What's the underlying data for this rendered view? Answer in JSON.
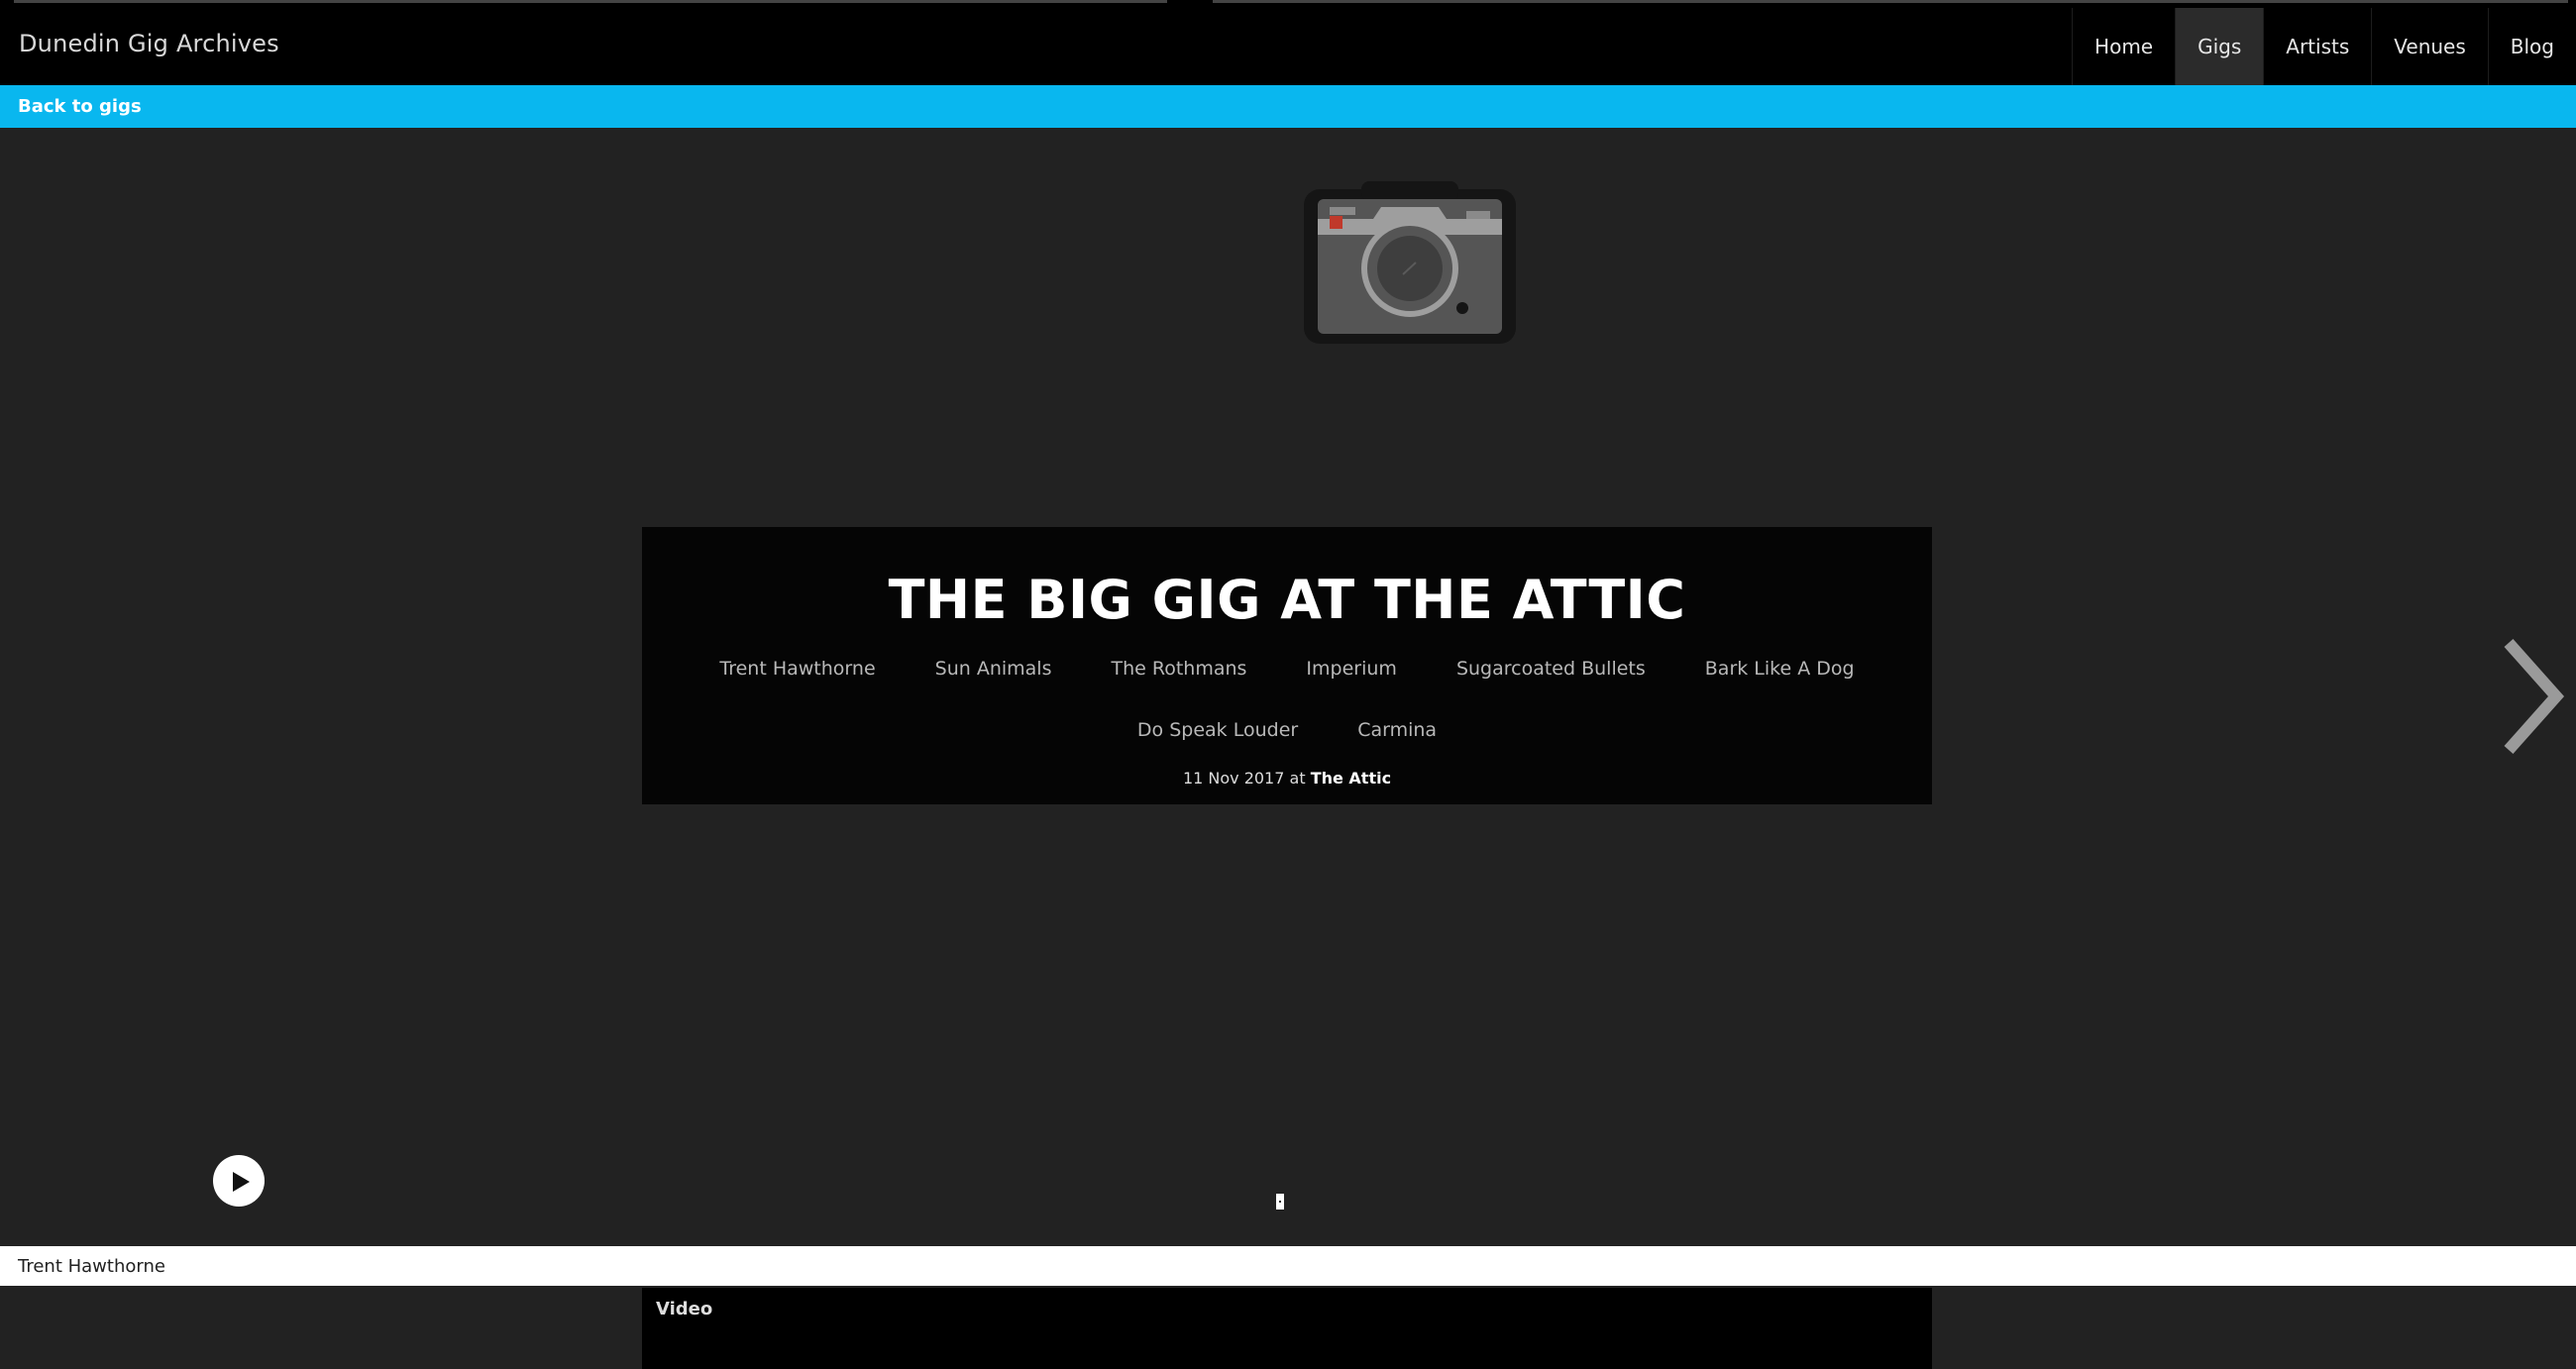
{
  "site": {
    "title": "Dunedin Gig Archives"
  },
  "nav": {
    "items": [
      {
        "label": "Home"
      },
      {
        "label": "Gigs"
      },
      {
        "label": "Artists"
      },
      {
        "label": "Venues"
      },
      {
        "label": "Blog"
      }
    ],
    "active": "Gigs"
  },
  "subnav": {
    "back_label": "Back to gigs"
  },
  "hero": {
    "image_icon": "camera-icon",
    "title": "THE BIG GIG AT THE ATTIC",
    "artists": [
      "Trent Hawthorne",
      "Sun Animals",
      "The Rothmans",
      "Imperium",
      "Sugarcoated Bullets",
      "Bark Like A Dog",
      "Do Speak Louder",
      "Carmina"
    ],
    "date": "11 Nov 2017",
    "at_word": "at",
    "venue": "The Attic",
    "next_icon": "chevron-right-icon"
  },
  "player": {
    "play_icon": "play-icon",
    "now_playing": "Trent Hawthorne"
  },
  "video": {
    "label": "Video"
  },
  "colors": {
    "accent": "#09b7ef",
    "background": "#222222",
    "navbar": "#000000",
    "panel": "#050505"
  }
}
